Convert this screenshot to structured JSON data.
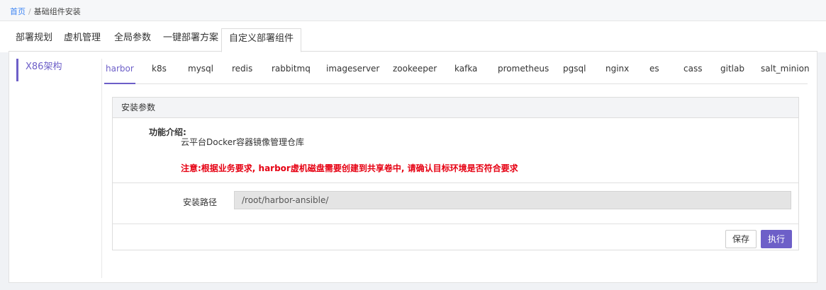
{
  "breadcrumb": {
    "home": "首页",
    "separator": "/",
    "current": "基础组件安装"
  },
  "top_tabs": [
    {
      "label": "部署规划"
    },
    {
      "label": "虚机管理"
    },
    {
      "label": "全局参数"
    },
    {
      "label": "一键部署方案"
    },
    {
      "label": "自定义部署组件",
      "active": true
    }
  ],
  "arch": {
    "items": [
      {
        "label": "X86架构",
        "active": true
      }
    ]
  },
  "component_tabs": [
    {
      "label": "harbor",
      "active": true
    },
    {
      "label": "k8s"
    },
    {
      "label": "mysql"
    },
    {
      "label": "redis"
    },
    {
      "label": "rabbitmq"
    },
    {
      "label": "imageserver"
    },
    {
      "label": "zookeeper"
    },
    {
      "label": "kafka"
    },
    {
      "label": "prometheus"
    },
    {
      "label": "pgsql"
    },
    {
      "label": "nginx"
    },
    {
      "label": "es"
    },
    {
      "label": "cass"
    },
    {
      "label": "gitlab"
    },
    {
      "label": "salt_minion"
    }
  ],
  "card": {
    "title": "安装参数",
    "intro_label": "功能介绍:",
    "intro_text": "云平台Docker容器镜像管理仓库",
    "warning": "注意:根据业务要求, harbor虚机磁盘需要创建到共享卷中, 请确认目标环境是否符合要求",
    "path_label": "安装路径",
    "path_value": "/root/harbor-ansible/",
    "save_label": "保存",
    "run_label": "执行"
  },
  "colors": {
    "accent": "#6d5fc8",
    "warning": "#e60012",
    "link": "#3f86f4"
  }
}
